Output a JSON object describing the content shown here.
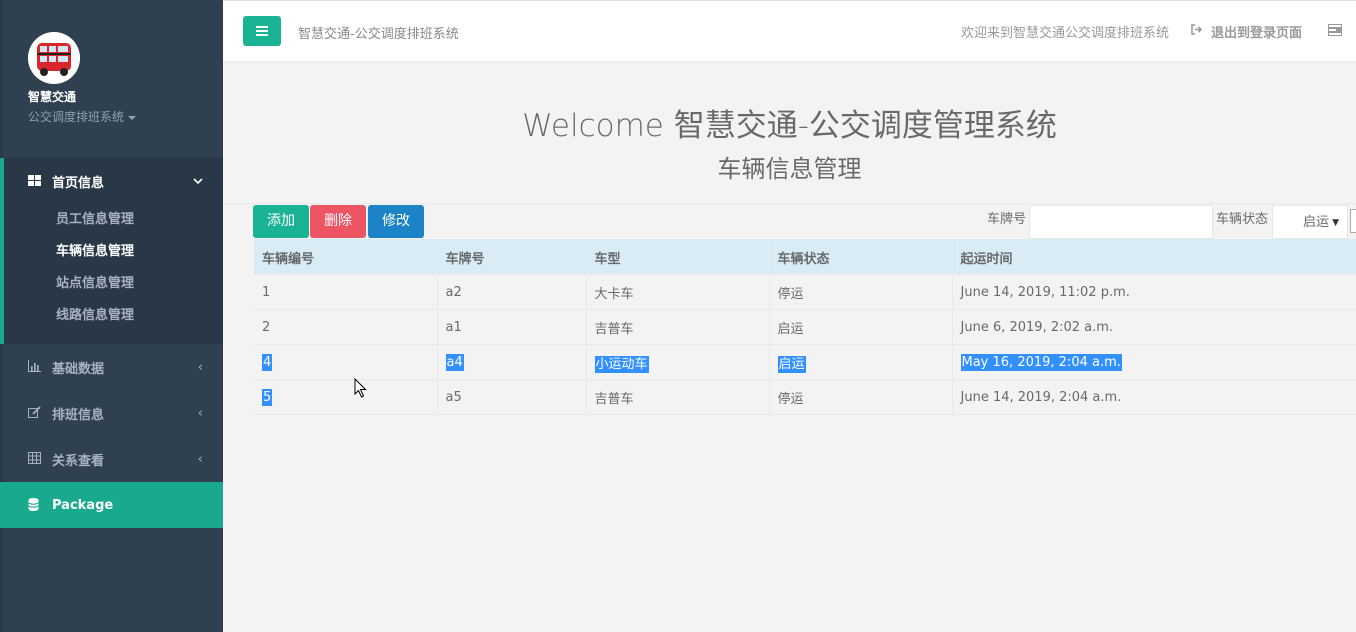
{
  "sidebar": {
    "app_name": "智慧交通",
    "app_sub": "公交调度排班系统",
    "nav": {
      "home": "首页信息",
      "sub_items": [
        "员工信息管理",
        "车辆信息管理",
        "站点信息管理",
        "线路信息管理"
      ],
      "basic_data": "基础数据",
      "schedule": "排班信息",
      "relations": "关系查看",
      "package": "Package"
    }
  },
  "topbar": {
    "title": "智慧交通-公交调度排班系统",
    "welcome": "欢迎来到智慧交通公交调度排班系统",
    "logout": "退出到登录页面"
  },
  "hero": {
    "title": "Welcome 智慧交通-公交调度管理系统",
    "subtitle": "车辆信息管理"
  },
  "toolbar": {
    "add": "添加",
    "delete": "删除",
    "edit": "修改",
    "plate_label": "车牌号",
    "status_label": "车辆状态",
    "status_value": "启运"
  },
  "table": {
    "headers": [
      "车辆编号",
      "车牌号",
      "车型",
      "车辆状态",
      "起运时间"
    ],
    "rows": [
      [
        "1",
        "a2",
        "大卡车",
        "停运",
        "June 14, 2019, 11:02 p.m."
      ],
      [
        "2",
        "a1",
        "吉普车",
        "启运",
        "June 6, 2019, 2:02 a.m."
      ],
      [
        "4",
        "a4",
        "小运动车",
        "启运",
        "May 16, 2019, 2:04 a.m."
      ],
      [
        "5",
        "a5",
        "吉普车",
        "停运",
        "June 14, 2019, 2:04 a.m."
      ]
    ]
  },
  "colors": {
    "sidebar_bg": "#2f4050",
    "primary": "#1ab394",
    "danger": "#ed5565",
    "info": "#1c84c6",
    "selection": "#3390ff"
  }
}
